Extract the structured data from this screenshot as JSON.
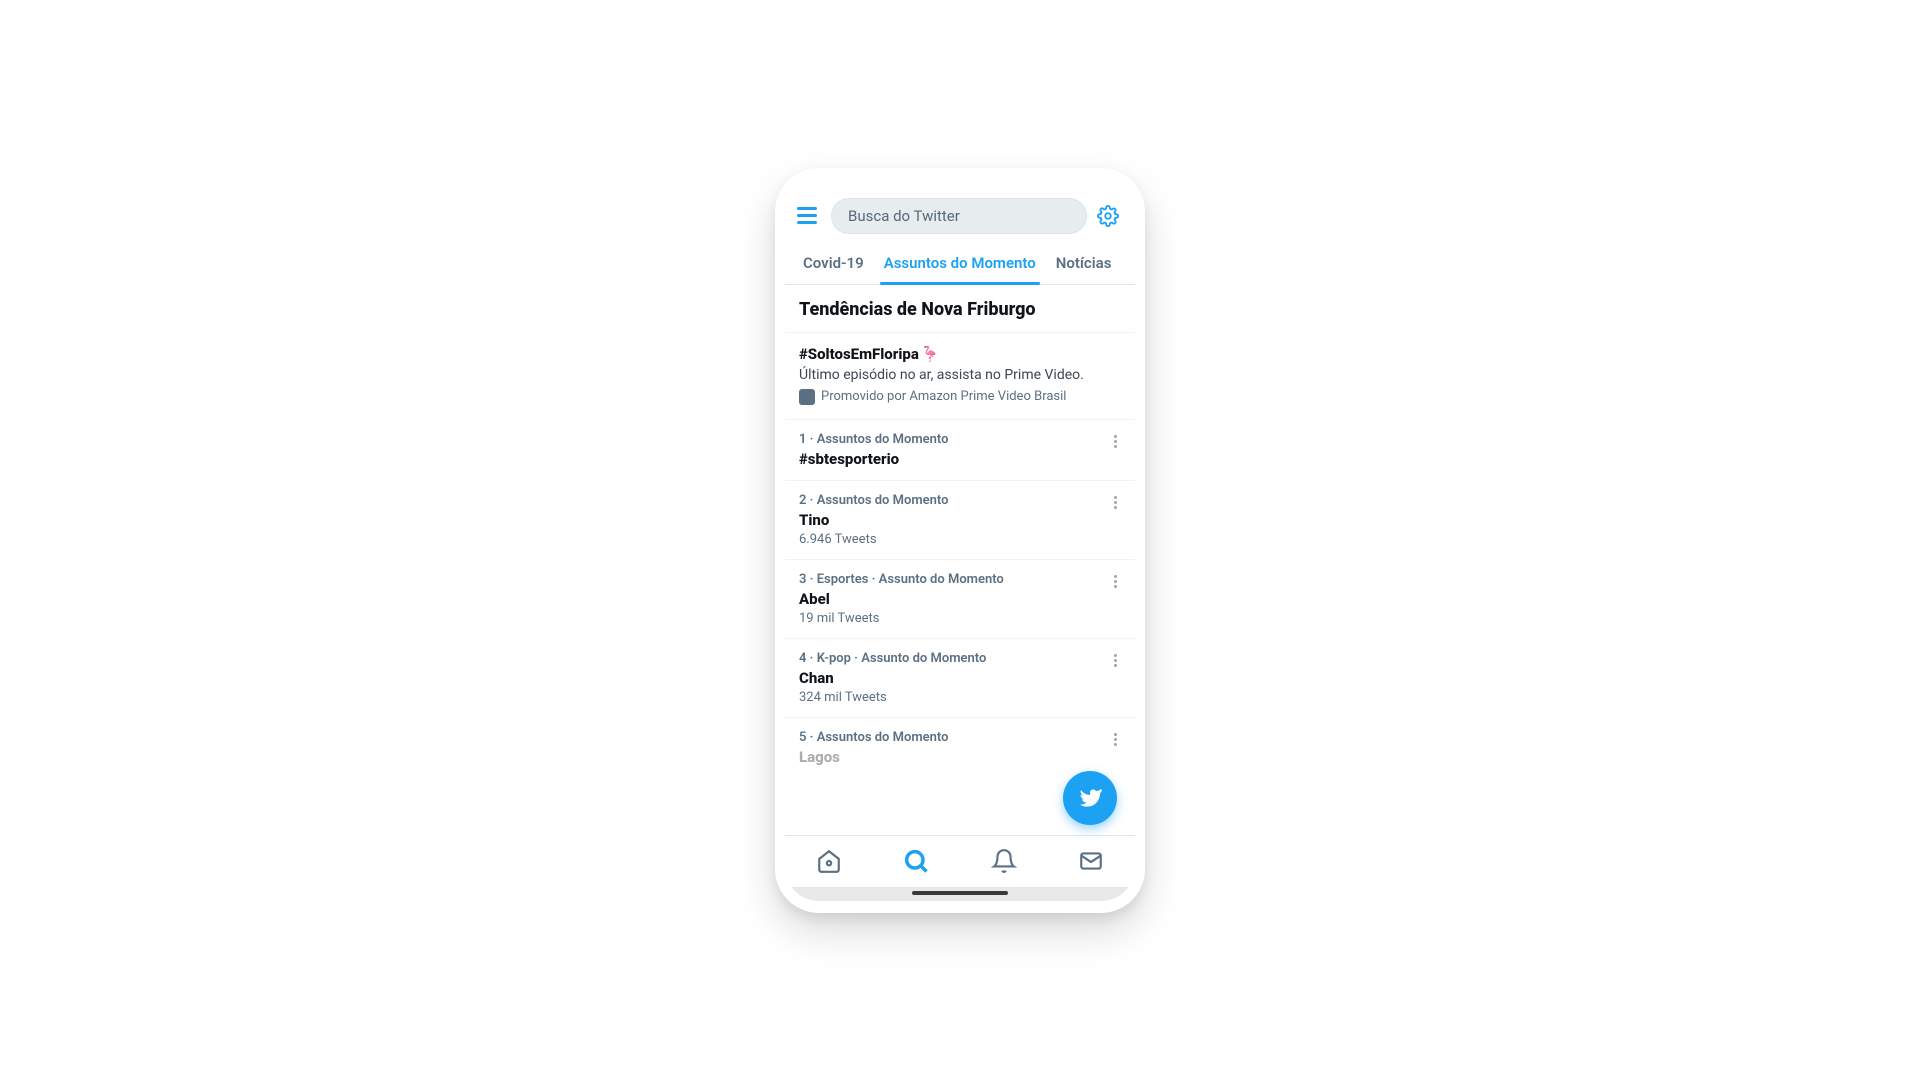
{
  "header": {
    "search_placeholder": "Busca do Twitter"
  },
  "tabs": [
    {
      "label": "Covid-19",
      "active": false
    },
    {
      "label": "Assuntos do Momento",
      "active": true
    },
    {
      "label": "Notícias",
      "active": false
    }
  ],
  "section_title": "Tendências de Nova Friburgo",
  "promoted": {
    "title": "#SoltosEmFloripa",
    "emoji": "🦩",
    "description": "Último episódio no ar, assista no Prime Video.",
    "by": "Promovido por Amazon Prime Video Brasil"
  },
  "trends": [
    {
      "rank": "1",
      "meta": "1 · Assuntos do Momento",
      "topic": "#sbtesporterio",
      "count": ""
    },
    {
      "rank": "2",
      "meta": "2 · Assuntos do Momento",
      "topic": "Tino",
      "count": "6.946 Tweets"
    },
    {
      "rank": "3",
      "meta": "3 · Esportes · Assunto do Momento",
      "topic": "Abel",
      "count": "19 mil Tweets"
    },
    {
      "rank": "4",
      "meta": "4 · K-pop · Assunto do Momento",
      "topic": "Chan",
      "count": "324 mil Tweets"
    },
    {
      "rank": "5",
      "meta": "5 · Assuntos do Momento",
      "topic": "Lagos",
      "count": ""
    }
  ],
  "colors": {
    "accent": "#1da1f2",
    "text": "#0f1419",
    "muted": "#5b7083"
  }
}
